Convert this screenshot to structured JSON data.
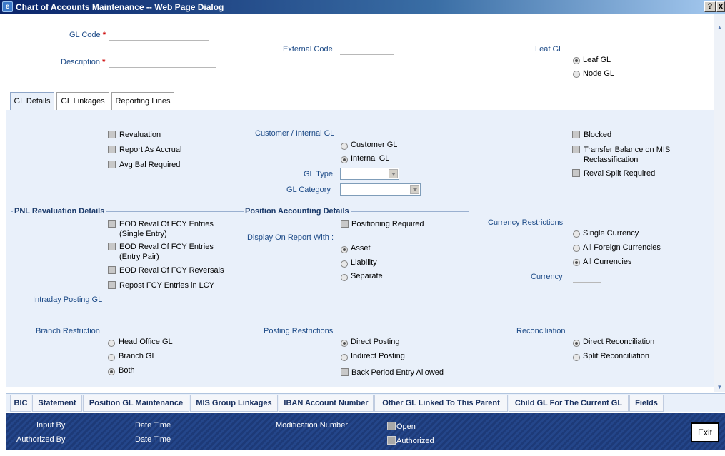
{
  "window": {
    "title": "Chart of Accounts Maintenance -- Web Page Dialog",
    "help_btn": "?",
    "close_btn": "x"
  },
  "header": {
    "gl_code_label": "GL Code",
    "description_label": "Description",
    "required_mark": "*",
    "external_code_label": "External Code",
    "leaf_gl_label": "Leaf GL",
    "leaf_options": [
      "Leaf GL",
      "Node GL"
    ]
  },
  "tabs": [
    "GL Details",
    "GL Linkages",
    "Reporting Lines"
  ],
  "gl_details": {
    "checks_left": [
      "Revaluation",
      "Report As Accrual",
      "Avg Bal Required"
    ],
    "customer_internal_label": "Customer / Internal GL",
    "customer_options": [
      "Customer GL",
      "Internal GL"
    ],
    "gl_type_label": "GL Type",
    "gl_category_label": "GL Category",
    "checks_right": [
      "Blocked",
      "Transfer Balance on MIS",
      "Reclassification",
      "Reval Split Required"
    ],
    "pnl_section": "PNL Revaluation Details",
    "pnl_checks": [
      "EOD Reval Of FCY Entries",
      "(Single Entry)",
      "EOD Reval Of FCY Entries",
      "(Entry Pair)",
      "EOD Reval Of FCY Reversals",
      "Repost FCY Entries in LCY"
    ],
    "position_section": "Position Accounting Details",
    "positioning_required": "Positioning Required",
    "display_on_report_label": "Display On Report With :",
    "display_options": [
      "Asset",
      "Liability",
      "Separate"
    ],
    "currency_restrictions_label": "Currency Restrictions",
    "currency_options": [
      "Single Currency",
      "All Foreign Currencies",
      "All Currencies"
    ],
    "currency_label": "Currency",
    "intraday_label": "Intraday Posting GL",
    "branch_restriction_label": "Branch Restriction",
    "branch_options": [
      "Head Office GL",
      "Branch GL",
      "Both"
    ],
    "posting_restrictions_label": "Posting Restrictions",
    "posting_options": [
      "Direct Posting",
      "Indirect Posting"
    ],
    "back_period": "Back Period Entry Allowed",
    "reconciliation_label": "Reconciliation",
    "reconciliation_options": [
      "Direct Reconciliation",
      "Split Reconciliation"
    ]
  },
  "subsystem_buttons": [
    "BIC",
    "Statement",
    "Position GL Maintenance",
    "MIS Group Linkages",
    "IBAN Account Number",
    "Other GL Linked To This Parent",
    "Child GL For The Current GL",
    "Fields"
  ],
  "footer": {
    "input_by": "Input By",
    "authorized_by": "Authorized By",
    "date_time_1": "Date Time",
    "date_time_2": "Date Time",
    "modification_number": "Modification Number",
    "open": "Open",
    "authorized": "Authorized",
    "exit": "Exit"
  },
  "colors": {
    "panel": "#e9f0fa",
    "label": "#1c4a87",
    "footer": "#1d3a78"
  }
}
